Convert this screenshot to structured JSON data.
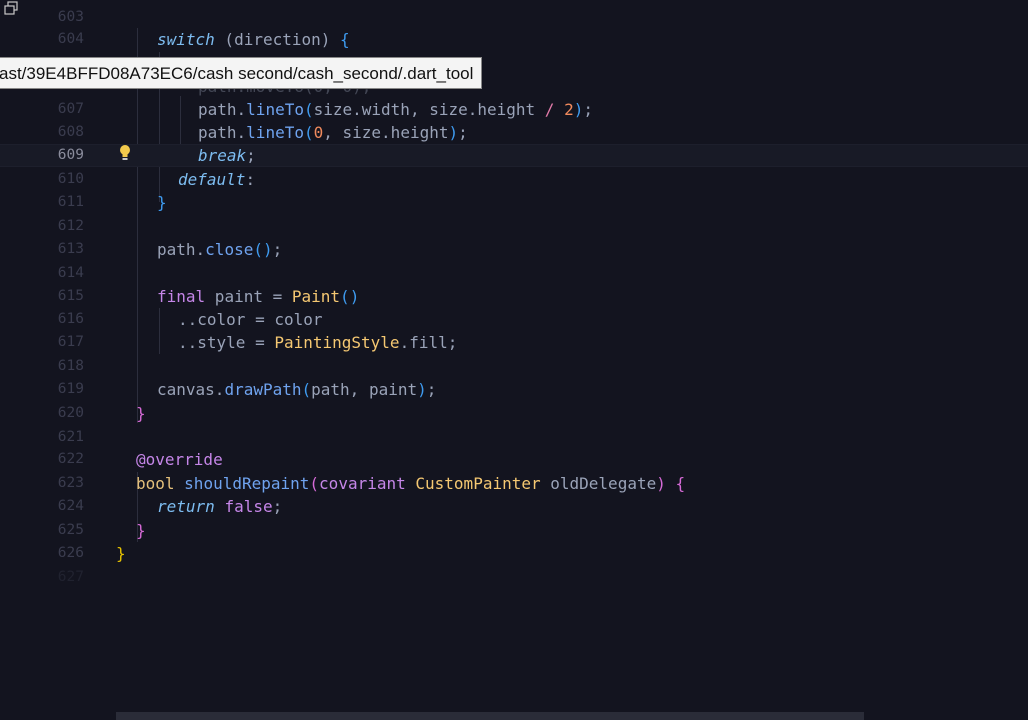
{
  "tooltip": {
    "path": "ast/39E4BFFD08A73EC6/cash second/cash_second/.dart_tool"
  },
  "icons": {
    "corner": "restore-window-icon",
    "lightbulb": "lightbulb-icon"
  },
  "colors": {
    "background": "#13141f",
    "tooltip_bg": "#f4f4f4",
    "line_number": "#3a3c4e"
  },
  "line_numbers": [
    "603",
    "604",
    "607",
    "608",
    "609",
    "610",
    "611",
    "612",
    "613",
    "614",
    "615",
    "616",
    "617",
    "618",
    "619",
    "620",
    "621",
    "622",
    "623",
    "624",
    "625",
    "626",
    "627"
  ],
  "active_line": "609",
  "code": {
    "l604_kw": "switch",
    "l604_rest": " (direction) ",
    "l605_text": "path.moveTo(0, 0);",
    "l607_a": "path.",
    "l607_fn": "lineTo",
    "l607_b": "size.width, size.height ",
    "l607_op": "/",
    "l607_num": "2",
    "l608_a": "path.",
    "l608_fn": "lineTo",
    "l608_num": "0",
    "l608_b": ", size.height",
    "l609_kw": "break",
    "l609_semi": ";",
    "l610_kw": "default",
    "l610_colon": ":",
    "l613_a": "path.",
    "l613_fn": "close",
    "l615_kw": "final",
    "l615_mid": " paint = ",
    "l615_cls": "Paint",
    "l616_text": "..color = color",
    "l617_a": "..style = ",
    "l617_cls": "PaintingStyle",
    "l617_b": ".fill;",
    "l619_a": "canvas.",
    "l619_fn": "drawPath",
    "l619_b": "path, paint",
    "l622_ann": "@override",
    "l623_kw": "bool",
    "l623_fn": "shouldRepaint",
    "l623_kw2": "covariant",
    "l623_cls": "CustomPainter",
    "l623_arg": " oldDelegate",
    "l624_kw": "return",
    "l624_val": "false",
    "brace_open": "{",
    "brace_close": "}",
    "paren_open": "(",
    "paren_close": ")",
    "semi": ";",
    "comma": ", "
  }
}
